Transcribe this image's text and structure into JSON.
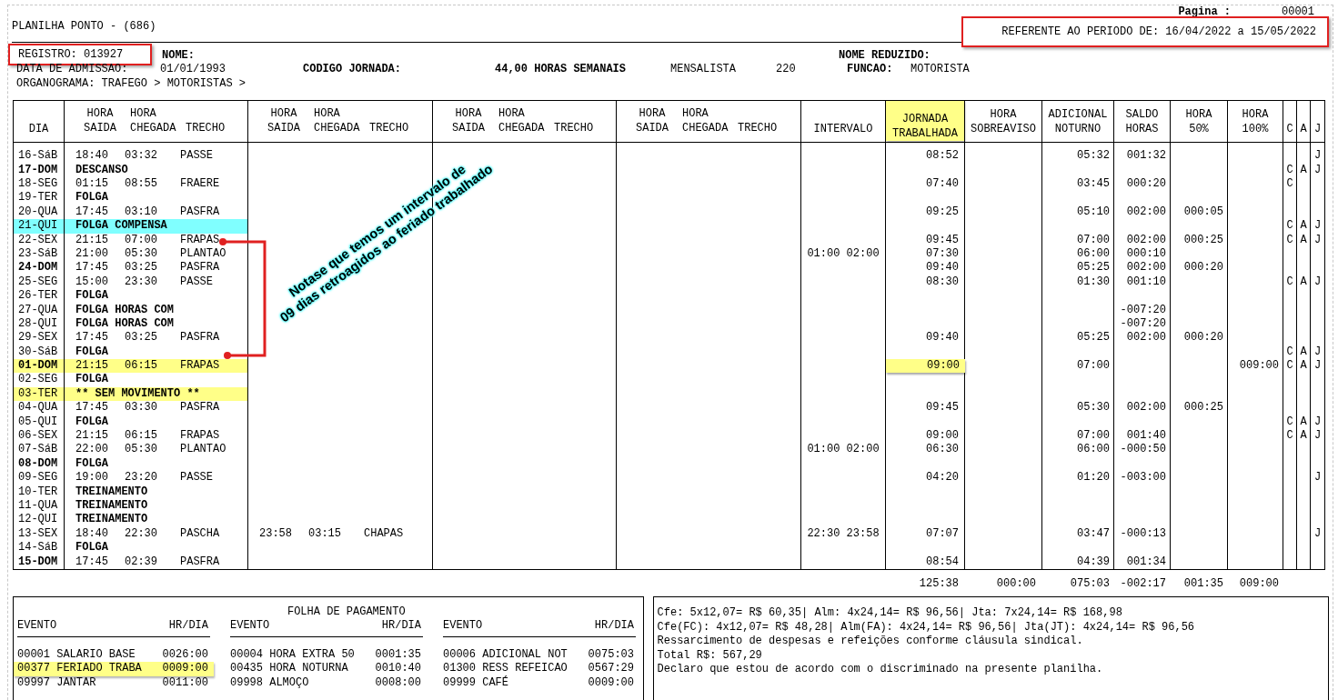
{
  "report": {
    "title": "PLANILHA PONTO - (686)",
    "page_label": "Pagina :",
    "page_number": "00001",
    "period": "REFERENTE AO PERIODO DE: 16/04/2022 a 15/05/2022",
    "period_marked": true
  },
  "employee": {
    "registro": "REGISTRO: 013927",
    "registro_marked": true,
    "nome_label": "NOME:",
    "nome_reduzido_label": "NOME REDUZIDO:",
    "admissao_label": "DATA DE ADMISSAO:",
    "admissao": "01/01/1993",
    "jornada_label": "CODIGO JORNADA:",
    "jornada": "44,00 HORAS SEMANAIS",
    "tipo": "MENSALISTA",
    "horas": "220",
    "funcao_label": "FUNCAO:",
    "funcao": "MOTORISTA",
    "organograma": "ORGANOGRAMA: TRAFEGO > MOTORISTAS >"
  },
  "columns": [
    {
      "kind": "single",
      "lines": [
        "DIA"
      ],
      "highlighted": false
    },
    {
      "kind": "group",
      "top": [
        "HORA",
        "HORA"
      ],
      "bottom": [
        "SAIDA",
        "CHEGADA",
        "TRECHO"
      ]
    },
    {
      "kind": "group",
      "top": [
        "HORA",
        "HORA"
      ],
      "bottom": [
        "SAIDA",
        "CHEGADA",
        "TRECHO"
      ]
    },
    {
      "kind": "group",
      "top": [
        "HORA",
        "HORA"
      ],
      "bottom": [
        "SAIDA",
        "CHEGADA",
        "TRECHO"
      ]
    },
    {
      "kind": "group",
      "top": [
        "HORA",
        "HORA"
      ],
      "bottom": [
        "SAIDA",
        "CHEGADA",
        "TRECHO"
      ]
    },
    {
      "kind": "single",
      "lines": [
        "INTERVALO"
      ],
      "highlighted": false
    },
    {
      "kind": "single",
      "lines": [
        "JORNADA",
        "TRABALHADA"
      ],
      "highlighted": true
    },
    {
      "kind": "single",
      "lines": [
        "HORA",
        "SOBREAVISO"
      ],
      "highlighted": false
    },
    {
      "kind": "single",
      "lines": [
        "ADICIONAL",
        "NOTURNO"
      ],
      "highlighted": false
    },
    {
      "kind": "single",
      "lines": [
        "SALDO",
        "HORAS"
      ],
      "highlighted": false
    },
    {
      "kind": "single",
      "lines": [
        "HORA",
        "50%"
      ],
      "highlighted": false
    },
    {
      "kind": "single",
      "lines": [
        "HORA",
        "100%"
      ],
      "highlighted": false
    },
    {
      "kind": "single",
      "lines": [
        "C"
      ],
      "highlighted": false
    },
    {
      "kind": "single",
      "lines": [
        "A"
      ],
      "highlighted": false
    },
    {
      "kind": "single",
      "lines": [
        "J"
      ],
      "highlighted": false
    }
  ],
  "rows": [
    {
      "day": "16-SáB",
      "bold": false,
      "highlighted": false,
      "kind": "shift",
      "segments": [
        {
          "saida": "18:40",
          "chegada": "03:32",
          "trecho": "PASSE"
        }
      ],
      "jornada": "08:52",
      "jornada_marked": false,
      "noturno": "05:32",
      "saldo": "001:32",
      "j": "J"
    },
    {
      "day": "17-DOM",
      "bold": true,
      "highlighted": false,
      "kind": "status",
      "status": "DESCANSO",
      "c": "C",
      "a": "A",
      "j": "J"
    },
    {
      "day": "18-SEG",
      "bold": false,
      "highlighted": false,
      "kind": "shift",
      "segments": [
        {
          "saida": "01:15",
          "chegada": "08:55",
          "trecho": "FRAERE"
        }
      ],
      "jornada": "07:40",
      "jornada_marked": false,
      "noturno": "03:45",
      "saldo": "000:20",
      "c": "C"
    },
    {
      "day": "19-TER",
      "bold": false,
      "highlighted": false,
      "kind": "status",
      "status": "FOLGA"
    },
    {
      "day": "20-QUA",
      "bold": false,
      "highlighted": false,
      "kind": "shift",
      "segments": [
        {
          "saida": "17:45",
          "chegada": "03:10",
          "trecho": "PASFRA"
        }
      ],
      "jornada": "09:25",
      "jornada_marked": false,
      "noturno": "05:10",
      "saldo": "002:00",
      "h50": "000:05"
    },
    {
      "day": "21-QUI",
      "bold": false,
      "highlighted": true,
      "color": "#80ffff",
      "kind": "status",
      "status": "FOLGA COMPENSA",
      "c": "C",
      "a": "A",
      "j": "J"
    },
    {
      "day": "22-SEX",
      "bold": false,
      "highlighted": false,
      "kind": "shift",
      "segments": [
        {
          "saida": "21:15",
          "chegada": "07:00",
          "trecho": "FRAPAS"
        }
      ],
      "jornada": "09:45",
      "jornada_marked": false,
      "noturno": "07:00",
      "saldo": "002:00",
      "h50": "000:25",
      "c": "C",
      "a": "A",
      "j": "J"
    },
    {
      "day": "23-SáB",
      "bold": false,
      "highlighted": false,
      "kind": "shift",
      "segments": [
        {
          "saida": "21:00",
          "chegada": "05:30",
          "trecho": "PLANTAO"
        }
      ],
      "intervalo": "01:00 02:00",
      "jornada": "07:30",
      "jornada_marked": false,
      "noturno": "06:00",
      "saldo": "000:10"
    },
    {
      "day": "24-DOM",
      "bold": true,
      "highlighted": false,
      "kind": "shift",
      "segments": [
        {
          "saida": "17:45",
          "chegada": "03:25",
          "trecho": "PASFRA"
        }
      ],
      "jornada": "09:40",
      "jornada_marked": false,
      "noturno": "05:25",
      "saldo": "002:00",
      "h50": "000:20"
    },
    {
      "day": "25-SEG",
      "bold": false,
      "highlighted": false,
      "kind": "shift",
      "segments": [
        {
          "saida": "15:00",
          "chegada": "23:30",
          "trecho": "PASSE"
        }
      ],
      "jornada": "08:30",
      "jornada_marked": false,
      "noturno": "01:30",
      "saldo": "001:10",
      "c": "C",
      "a": "A",
      "j": "J"
    },
    {
      "day": "26-TER",
      "bold": false,
      "highlighted": false,
      "kind": "status",
      "status": "FOLGA"
    },
    {
      "day": "27-QUA",
      "bold": false,
      "highlighted": false,
      "kind": "status",
      "status": "FOLGA HORAS COM",
      "saldo": "-007:20"
    },
    {
      "day": "28-QUI",
      "bold": false,
      "highlighted": false,
      "kind": "status",
      "status": "FOLGA HORAS COM",
      "saldo": "-007:20"
    },
    {
      "day": "29-SEX",
      "bold": false,
      "highlighted": false,
      "kind": "shift",
      "segments": [
        {
          "saida": "17:45",
          "chegada": "03:25",
          "trecho": "PASFRA"
        }
      ],
      "jornada": "09:40",
      "jornada_marked": false,
      "noturno": "05:25",
      "saldo": "002:00",
      "h50": "000:20"
    },
    {
      "day": "30-SáB",
      "bold": false,
      "highlighted": false,
      "kind": "status",
      "status": "FOLGA",
      "c": "C",
      "a": "A",
      "j": "J"
    },
    {
      "day": "01-DOM",
      "bold": true,
      "highlighted": true,
      "color": "#ffff88",
      "kind": "shift",
      "segments": [
        {
          "saida": "21:15",
          "chegada": "06:15",
          "trecho": "FRAPAS"
        }
      ],
      "jornada": "09:00",
      "jornada_marked": true,
      "noturno": "07:00",
      "h100": "009:00",
      "c": "C",
      "a": "A",
      "j": "J"
    },
    {
      "day": "02-SEG",
      "bold": false,
      "highlighted": false,
      "kind": "status",
      "status": "FOLGA"
    },
    {
      "day": "03-TER",
      "bold": false,
      "highlighted": true,
      "color": "#ffff88",
      "kind": "status",
      "status": "** SEM MOVIMENTO **"
    },
    {
      "day": "04-QUA",
      "bold": false,
      "highlighted": false,
      "kind": "shift",
      "segments": [
        {
          "saida": "17:45",
          "chegada": "03:30",
          "trecho": "PASFRA"
        }
      ],
      "jornada": "09:45",
      "jornada_marked": false,
      "noturno": "05:30",
      "saldo": "002:00",
      "h50": "000:25"
    },
    {
      "day": "05-QUI",
      "bold": false,
      "highlighted": false,
      "kind": "status",
      "status": "FOLGA",
      "c": "C",
      "a": "A",
      "j": "J"
    },
    {
      "day": "06-SEX",
      "bold": false,
      "highlighted": false,
      "kind": "shift",
      "segments": [
        {
          "saida": "21:15",
          "chegada": "06:15",
          "trecho": "FRAPAS"
        }
      ],
      "jornada": "09:00",
      "jornada_marked": false,
      "noturno": "07:00",
      "saldo": "001:40",
      "c": "C",
      "a": "A",
      "j": "J"
    },
    {
      "day": "07-SáB",
      "bold": false,
      "highlighted": false,
      "kind": "shift",
      "segments": [
        {
          "saida": "22:00",
          "chegada": "05:30",
          "trecho": "PLANTAO"
        }
      ],
      "intervalo": "01:00 02:00",
      "jornada": "06:30",
      "jornada_marked": false,
      "noturno": "06:00",
      "saldo": "-000:50"
    },
    {
      "day": "08-DOM",
      "bold": true,
      "highlighted": false,
      "kind": "status",
      "status": "FOLGA"
    },
    {
      "day": "09-SEG",
      "bold": false,
      "highlighted": false,
      "kind": "shift",
      "segments": [
        {
          "saida": "19:00",
          "chegada": "23:20",
          "trecho": "PASSE"
        }
      ],
      "jornada": "04:20",
      "jornada_marked": false,
      "noturno": "01:20",
      "saldo": "-003:00",
      "j": "J"
    },
    {
      "day": "10-TER",
      "bold": false,
      "highlighted": false,
      "kind": "status",
      "status": "TREINAMENTO"
    },
    {
      "day": "11-QUA",
      "bold": false,
      "highlighted": false,
      "kind": "status",
      "status": "TREINAMENTO"
    },
    {
      "day": "12-QUI",
      "bold": false,
      "highlighted": false,
      "kind": "status",
      "status": "TREINAMENTO"
    },
    {
      "day": "13-SEX",
      "bold": false,
      "highlighted": false,
      "kind": "shift",
      "segments": [
        {
          "saida": "18:40",
          "chegada": "22:30",
          "trecho": "PASCHA"
        },
        {
          "saida": "23:58",
          "chegada": "03:15",
          "trecho": "CHAPAS"
        }
      ],
      "intervalo": "22:30 23:58",
      "jornada": "07:07",
      "jornada_marked": false,
      "noturno": "03:47",
      "saldo": "-000:13",
      "j": "J"
    },
    {
      "day": "14-SáB",
      "bold": false,
      "highlighted": false,
      "kind": "status",
      "status": "FOLGA"
    },
    {
      "day": "15-DOM",
      "bold": true,
      "highlighted": false,
      "kind": "shift",
      "segments": [
        {
          "saida": "17:45",
          "chegada": "02:39",
          "trecho": "PASFRA"
        }
      ],
      "jornada": "08:54",
      "jornada_marked": false,
      "noturno": "04:39",
      "saldo": "001:34"
    }
  ],
  "totals": {
    "jornada": "125:38",
    "sobreaviso": "000:00",
    "noturno": "075:03",
    "saldo": "-002:17",
    "h50": "001:35",
    "h100": "009:00"
  },
  "callout": {
    "lines": [
      "Notase que temos um intervalo de",
      "09 dias retroagidos ao feriado trabalhado"
    ]
  },
  "payroll": {
    "title": "FOLHA DE PAGAMENTO",
    "headers": [
      {
        "evento": "EVENTO",
        "hr": "HR/DIA"
      },
      {
        "evento": "EVENTO",
        "hr": "HR/DIA"
      },
      {
        "evento": "EVENTO",
        "hr": "HR/DIA"
      }
    ],
    "columns": [
      [
        {
          "event": "00001 SALARIO BASE",
          "hours": "0026:00",
          "marked": false
        },
        {
          "event": "00377 FERIADO TRABA",
          "hours": "0009:00",
          "marked": true
        },
        {
          "event": "09997 JANTAR",
          "hours": "0011:00",
          "marked": false
        }
      ],
      [
        {
          "event": "00004 HORA EXTRA 50",
          "hours": "0001:35",
          "marked": false
        },
        {
          "event": "00435 HORA NOTURNA",
          "hours": "0010:40",
          "marked": false
        },
        {
          "event": "09998 ALMOÇO",
          "hours": "0008:00",
          "marked": false
        }
      ],
      [
        {
          "event": "00006 ADICIONAL NOT",
          "hours": "0075:03",
          "marked": false
        },
        {
          "event": "01300 RESS REFEICAO",
          "hours": "0567:29",
          "marked": false
        },
        {
          "event": "09999 CAFÉ",
          "hours": "0009:00",
          "marked": false
        }
      ]
    ]
  },
  "notes": [
    "Cfe: 5x12,07= R$ 60,35| Alm: 4x24,14= R$ 96,56| Jta: 7x24,14= R$ 168,98",
    "Cfe(FC): 4x12,07= R$ 48,28| Alm(FA): 4x24,14= R$ 96,56| Jta(JT): 4x24,14= R$ 96,56",
    "Ressarcimento de despesas e refeições conforme cláusula sindical.",
    "Total R$: 567,29",
    "Declaro que estou de acordo com o discriminado na presente planilha."
  ]
}
